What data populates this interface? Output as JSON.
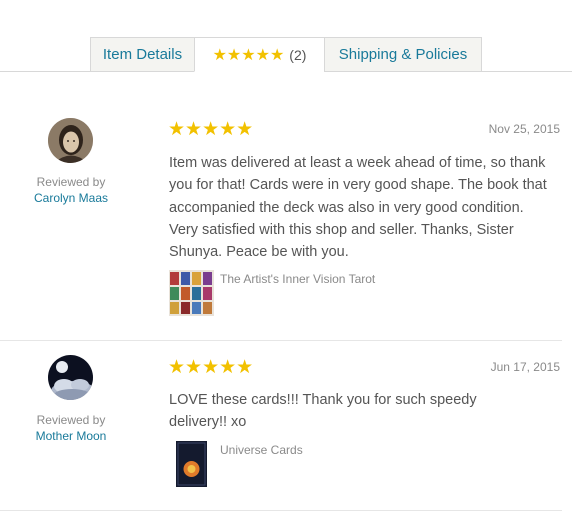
{
  "tabs": {
    "item_details": "Item Details",
    "reviews_stars": "★★★★★",
    "reviews_count": "(2)",
    "shipping": "Shipping & Policies"
  },
  "reviews": [
    {
      "rating": "★★★★★",
      "date": "Nov 25, 2015",
      "reviewed_by": "Reviewed by",
      "reviewer": "Carolyn Maas",
      "text": "Item was delivered at least a week ahead of time, so thank you for that! Cards were in very good shape. The book that accompanied the deck was also in very good condition. Very satisfied with this shop and seller. Thanks, Sister Shunya. Peace be with you.",
      "item": "The Artist's Inner Vision Tarot"
    },
    {
      "rating": "★★★★★",
      "date": "Jun 17, 2015",
      "reviewed_by": "Reviewed by",
      "reviewer": "Mother Moon",
      "text": "LOVE these cards!!! Thank you for such speedy delivery!! xo",
      "item": "Universe Cards",
      "thumb_lettering": "UNIVERSE CARDS"
    }
  ],
  "colors": {
    "link": "#197a9a",
    "star": "#f2c100",
    "muted": "#8a8a8a",
    "border": "#d8d8d8"
  }
}
